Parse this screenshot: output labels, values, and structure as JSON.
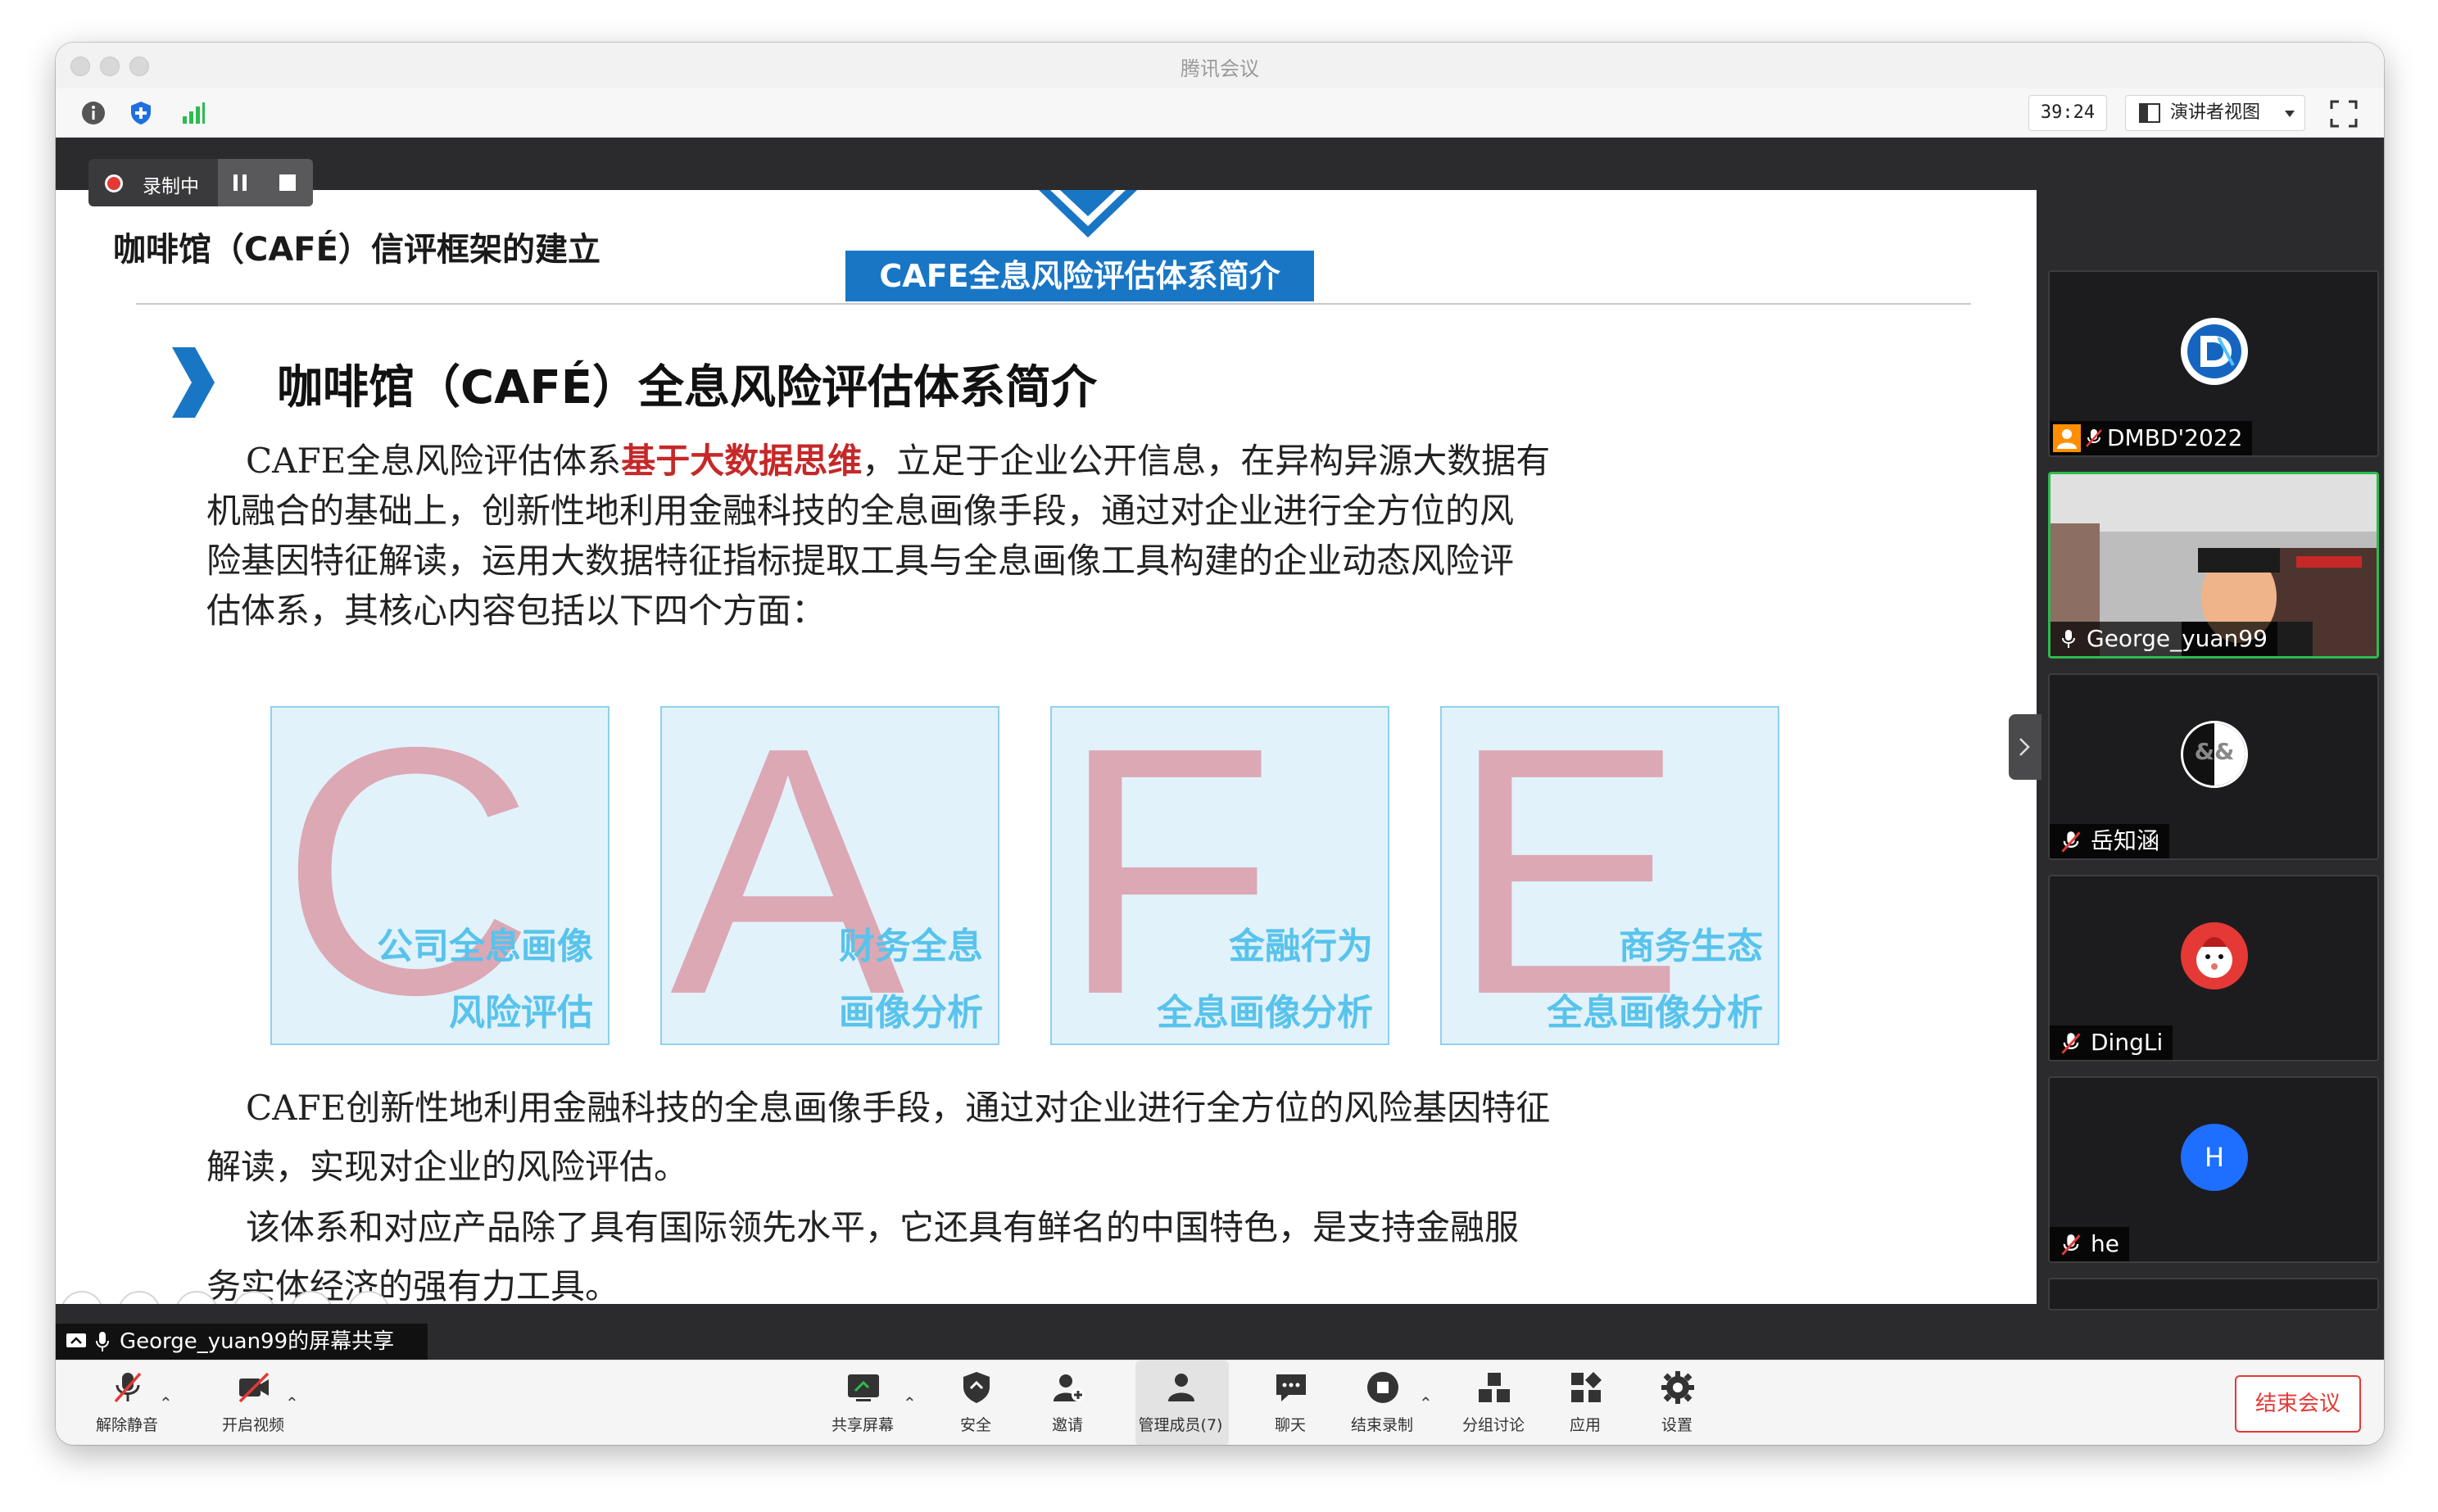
{
  "window": {
    "title": "腾讯会议"
  },
  "toolbar": {
    "timer": "39:24",
    "view_label": "演讲者视图"
  },
  "recording": {
    "label": "录制中"
  },
  "slide": {
    "title": "咖啡馆（CAFÉ）信评框架的建立",
    "tab": "CAFE全息风险评估体系简介",
    "heading": "咖啡馆（CAFÉ）全息风险评估体系简介",
    "p1": {
      "l1_pre": "CAFE全息风险评估体系",
      "l1_hl": "基于大数据思维",
      "l1_post": "，立足于企业公开信息，在异构异源大数据有",
      "l2": "机融合的基础上，创新性地利用金融科技的全息画像手段，通过对企业进行全方位的风",
      "l3": "险基因特征解读，运用大数据特征指标提取工具与全息画像工具构建的企业动态风险评",
      "l4": "估体系，其核心内容包括以下四个方面："
    },
    "cards": [
      {
        "letter": "C",
        "line1": "公司全息画像",
        "line2": "风险评估"
      },
      {
        "letter": "A",
        "line1": "财务全息",
        "line2": "画像分析"
      },
      {
        "letter": "F",
        "line1": "金融行为",
        "line2": "全息画像分析"
      },
      {
        "letter": "E",
        "line1": "商务生态",
        "line2": "全息画像分析"
      }
    ],
    "p2": {
      "l1": "CAFE创新性地利用金融科技的全息画像手段，通过对企业进行全方位的风险基因特征",
      "l2": "解读，实现对企业的风险评估。",
      "l3": "该体系和对应产品除了具有国际领先水平，它还具有鲜名的中国特色，是支持金融服",
      "l4": "务实体经济的强有力工具。"
    }
  },
  "share_badge": "George_yuan99的屏幕共享",
  "participants": [
    {
      "name": "DMBD'2022",
      "avatar_text": "D"
    },
    {
      "name": "George_yuan99"
    },
    {
      "name": "岳知涵",
      "avatar_text": "&&"
    },
    {
      "name": "DingLi"
    },
    {
      "name": "he",
      "avatar_text": "H"
    }
  ],
  "bottom": {
    "unmute": "解除静音",
    "start_video": "开启视频",
    "share": "共享屏幕",
    "security": "安全",
    "invite": "邀请",
    "members": "管理成员(7)",
    "chat": "聊天",
    "stop_record": "结束录制",
    "breakout": "分组讨论",
    "apps": "应用",
    "settings": "设置",
    "end_meeting": "结束会议"
  },
  "colors": {
    "accent_blue": "#1976c5",
    "highlight_red": "#c62828",
    "active_green": "#2dbb4f",
    "end_red": "#e53935"
  }
}
